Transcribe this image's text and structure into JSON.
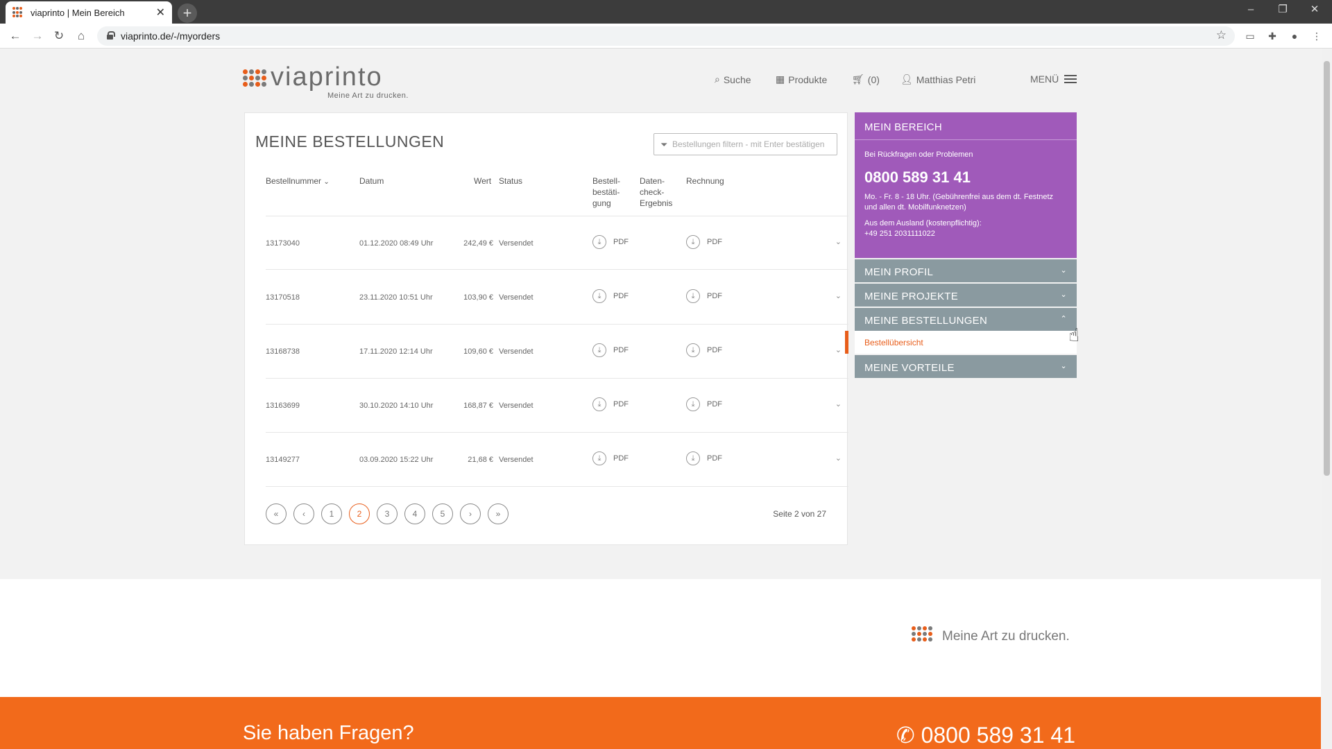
{
  "browser": {
    "tab_title": "viaprinto | Mein Bereich",
    "url": "viaprinto.de/-/myorders"
  },
  "header": {
    "logo_text": "viaprinto",
    "tagline": "Meine Art zu drucken.",
    "nav": {
      "search": "Suche",
      "products": "Produkte",
      "cart": "(0)",
      "user": "Matthias Petri",
      "menu": "MENÜ"
    }
  },
  "orders": {
    "title": "MEINE BESTELLUNGEN",
    "filter_placeholder": "Bestellungen filtern - mit Enter bestätigen",
    "columns": {
      "number": "Bestellnummer",
      "date": "Datum",
      "value": "Wert",
      "status": "Status",
      "confirmation_l1": "Bestell-",
      "confirmation_l2": "bestäti-",
      "confirmation_l3": "gung",
      "datacheck_l1": "Daten-",
      "datacheck_l2": "check-",
      "datacheck_l3": "Ergebnis",
      "invoice": "Rechnung"
    },
    "rows": [
      {
        "number": "13173040",
        "date": "01.12.2020 08:49 Uhr",
        "value": "242,49 €",
        "status": "Versendet",
        "confirmation": "PDF",
        "invoice": "PDF"
      },
      {
        "number": "13170518",
        "date": "23.11.2020 10:51 Uhr",
        "value": "103,90 €",
        "status": "Versendet",
        "confirmation": "PDF",
        "invoice": "PDF"
      },
      {
        "number": "13168738",
        "date": "17.11.2020 12:14 Uhr",
        "value": "109,60 €",
        "status": "Versendet",
        "confirmation": "PDF",
        "invoice": "PDF"
      },
      {
        "number": "13163699",
        "date": "30.10.2020 14:10 Uhr",
        "value": "168,87 €",
        "status": "Versendet",
        "confirmation": "PDF",
        "invoice": "PDF"
      },
      {
        "number": "13149277",
        "date": "03.09.2020 15:22 Uhr",
        "value": "21,68 €",
        "status": "Versendet",
        "confirmation": "PDF",
        "invoice": "PDF"
      }
    ],
    "pagination": {
      "first": "«",
      "prev": "‹",
      "pages": [
        "1",
        "2",
        "3",
        "4",
        "5"
      ],
      "next": "›",
      "last": "»",
      "active_page": "2",
      "info": "Seite 2 von 27"
    }
  },
  "sidebar": {
    "title": "MEIN BEREICH",
    "contact_intro": "Bei Rückfragen oder Problemen",
    "phone": "0800 589 31 41",
    "hours": "Mo. - Fr. 8 - 18 Uhr. (Gebührenfrei aus dem dt. Festnetz und allen dt. Mobilfunknetzen)",
    "abroad_label": "Aus dem Ausland (kostenpflichtig):",
    "abroad_phone": "+49 251 2031111022",
    "sections": {
      "profile": "MEIN PROFIL",
      "projects": "MEINE PROJEKTE",
      "orders": "MEINE BESTELLUNGEN",
      "orders_sub": "Bestellübersicht",
      "benefits": "MEINE VORTEILE"
    }
  },
  "footer": {
    "slogan": "Meine Art zu drucken.",
    "question": "Sie haben Fragen?",
    "phone": "0800 589 31 41"
  },
  "colors": {
    "brand_orange": "#f26a1b",
    "sidebar_purple": "#a05aba",
    "accordion_gray": "#8a9aa0"
  }
}
